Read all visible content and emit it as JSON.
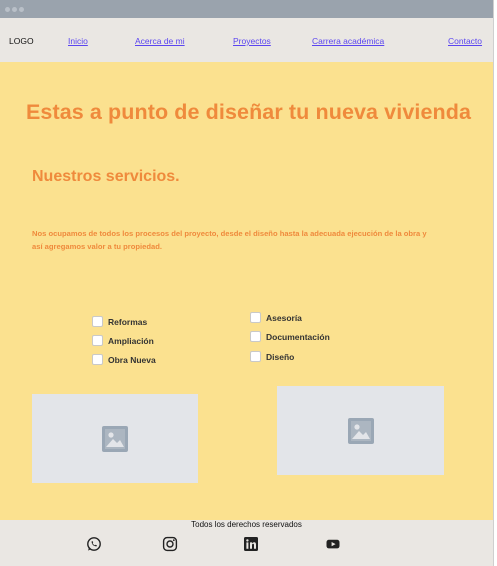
{
  "nav": {
    "logo": "LOGO",
    "links": [
      "Inicio",
      "Acerca de mi",
      "Proyectos",
      "Carrera académica",
      "Contacto"
    ]
  },
  "hero": {
    "title": "Estas a punto de diseñar tu nueva vivienda"
  },
  "services": {
    "title": "Nuestros servicios.",
    "description": "Nos ocupamos de todos los procesos del proyecto, desde el diseño hasta la adecuada ejecución de la obra y así agregamos valor a tu propiedad.",
    "left_options": [
      "Reformas",
      "Ampliación",
      "Obra Nueva"
    ],
    "right_options": [
      "Asesoría",
      "Documentación",
      "Diseño"
    ]
  },
  "images": {
    "icon": "image-placeholder-icon"
  },
  "footer": {
    "text": "Todos los derechos reservados",
    "social_icons": [
      "whatsapp-icon",
      "instagram-icon",
      "linkedin-icon",
      "youtube-icon"
    ]
  },
  "colors": {
    "accent": "#ef8a3c",
    "background": "#fbe18f",
    "nav_link": "#5b45f0"
  }
}
